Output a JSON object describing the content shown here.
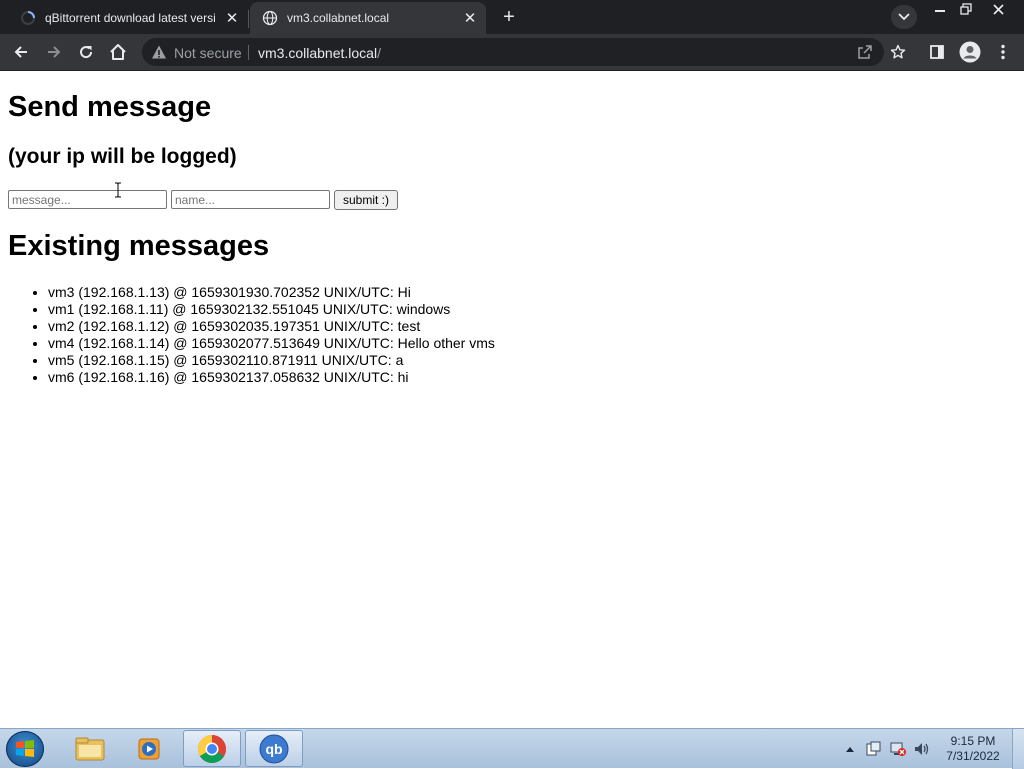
{
  "browser": {
    "tabs": [
      {
        "title": "qBittorrent download latest versi",
        "active": false
      },
      {
        "title": "vm3.collabnet.local",
        "active": true
      }
    ],
    "omnibox": {
      "security_label": "Not secure",
      "url_host": "vm3.collabnet.local",
      "url_path": "/"
    }
  },
  "page": {
    "heading_send": "Send message",
    "heading_ip": "(your ip will be logged)",
    "message_placeholder": "message...",
    "name_placeholder": "name...",
    "submit_label": "submit :)",
    "heading_existing": "Existing messages",
    "messages": [
      "vm3 (192.168.1.13) @ 1659301930.702352 UNIX/UTC: Hi",
      "vm1 (192.168.1.11) @ 1659302132.551045 UNIX/UTC: windows",
      "vm2 (192.168.1.12) @ 1659302035.197351 UNIX/UTC: test",
      "vm4 (192.168.1.14) @ 1659302077.513649 UNIX/UTC: Hello other vms",
      "vm5 (192.168.1.15) @ 1659302110.871911 UNIX/UTC: a",
      "vm6 (192.168.1.16) @ 1659302137.058632 UNIX/UTC: hi"
    ]
  },
  "taskbar": {
    "apps": [
      {
        "name": "file-explorer",
        "icon": "folder-icon"
      },
      {
        "name": "media-player",
        "icon": "media-player-icon"
      },
      {
        "name": "chrome",
        "icon": "chrome-icon",
        "active": true
      },
      {
        "name": "qbittorrent",
        "icon": "qbittorrent-icon",
        "active": true,
        "label": "qb"
      }
    ],
    "clock": {
      "time": "9:15 PM",
      "date": "7/31/2022"
    }
  },
  "colors": {
    "tabstrip_bg": "#1f2023",
    "toolbar_bg": "#35363a",
    "omnibox_bg": "#202124",
    "taskbar_bg": "#b7cce4"
  }
}
